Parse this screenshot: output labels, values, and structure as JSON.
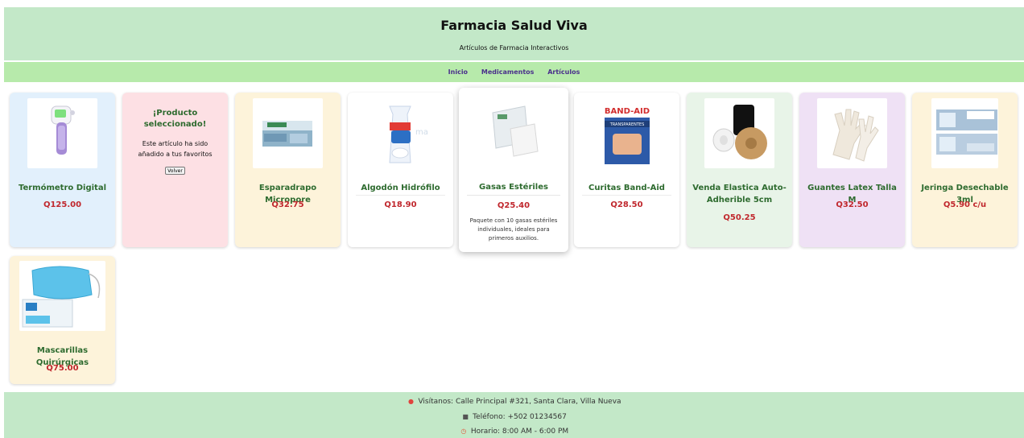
{
  "header": {
    "title": "Farmacia Salud Viva",
    "subtitle": "Artículos de Farmacia Interactivos"
  },
  "nav": {
    "items": [
      "Inicio",
      "Medicamentos",
      "Artículos"
    ]
  },
  "products": [
    {
      "name": "Termómetro Digital",
      "price": "Q125.00",
      "icon": "thermometer-image"
    },
    {
      "selected": true,
      "message_title": "¡Producto seleccionado!",
      "message_body": "Este artículo ha sido añadido a tus favoritos",
      "button": "Volver"
    },
    {
      "name": "Esparadrapo Micropore",
      "price": "Q32.75",
      "icon": "tape-box-image"
    },
    {
      "name": "Algodón Hidrófilo",
      "price": "Q18.90",
      "icon": "cotton-bag-image"
    },
    {
      "name": "Gasas Estériles",
      "price": "Q25.40",
      "description": "Paquete con 10 gasas estériles individuales, ideales para primeros auxilios.",
      "icon": "gauze-image"
    },
    {
      "name": "Curitas Band-Aid",
      "price": "Q28.50",
      "icon": "bandaid-box-image",
      "brand": "BAND-AID",
      "brand_sub": "TRANSPARENTES"
    },
    {
      "name": "Venda Elastica Auto-Adherible 5cm",
      "price": "Q50.25",
      "icon": "elastic-bandage-image"
    },
    {
      "name": "Guantes Latex Talla M",
      "price": "Q32.50",
      "icon": "latex-gloves-image"
    },
    {
      "name": "Jeringa Desechable 3ml",
      "price": "Q5.90 c/u",
      "icon": "syringe-box-image"
    },
    {
      "name": "Mascarillas Quirúrgicas",
      "price": "Q75.00",
      "icon": "surgical-masks-image"
    }
  ],
  "footer": {
    "address": "Visítanos: Calle Principal #321, Santa Clara, Villa Nueva",
    "phone": "Teléfono: +502 01234567",
    "hours": "Horario: 8:00 AM - 6:00 PM",
    "icons": [
      "pin-icon",
      "phone-icon",
      "clock-icon"
    ]
  },
  "colors": {
    "header_bg": "#c3e8c8",
    "nav_bg": "#b7eaab",
    "nav_link": "#4a2f8c",
    "product_name": "#2e6b2f",
    "price": "#c0272d"
  }
}
